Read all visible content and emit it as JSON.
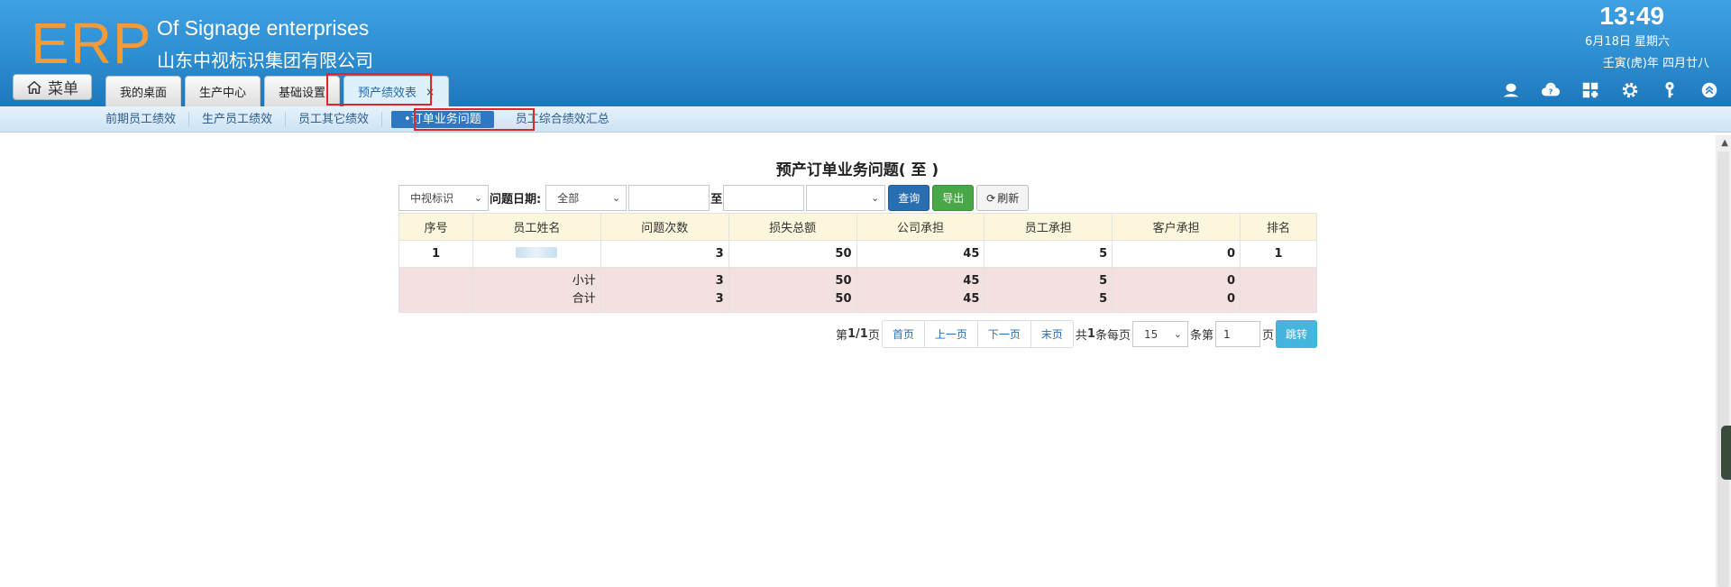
{
  "header": {
    "logo": "ERP",
    "enterprise_en": "Of Signage enterprises",
    "enterprise_cn": "山东中视标识集团有限公司",
    "time": "13:49",
    "date": "6月18日 星期六",
    "lunar": "壬寅(虎)年 四月廿八",
    "menu_label": "菜单"
  },
  "tabs": [
    {
      "label": "我的桌面"
    },
    {
      "label": "生产中心"
    },
    {
      "label": "基础设置"
    },
    {
      "label": "预产绩效表",
      "close": "×"
    }
  ],
  "toolbar_icons": [
    "user-icon",
    "help-cloud-icon",
    "dashboard-icon",
    "settings-gear-icon",
    "key-icon",
    "collapse-up-icon"
  ],
  "subnav": [
    {
      "label": "前期员工绩效"
    },
    {
      "label": "生产员工绩效"
    },
    {
      "label": "员工其它绩效"
    },
    {
      "label": "•订单业务问题"
    },
    {
      "label": "员工综合绩效汇总"
    }
  ],
  "page": {
    "title": "预产订单业务问题( 至 )"
  },
  "filter": {
    "company": "中视标识",
    "date_label": "问题日期:",
    "date_range": "全部",
    "to_label": "至",
    "extra_select": "",
    "query": "查询",
    "export": "导出",
    "refresh": "刷新"
  },
  "table": {
    "headers": [
      "序号",
      "员工姓名",
      "问题次数",
      "损失总额",
      "公司承担",
      "员工承担",
      "客户承担",
      "排名"
    ],
    "rows": [
      {
        "no": "1",
        "name": "",
        "count": "3",
        "loss": "50",
        "company": "45",
        "employee": "5",
        "customer": "0",
        "rank": "1"
      }
    ],
    "subtotal": {
      "label": "小计",
      "count": "3",
      "loss": "50",
      "company": "45",
      "employee": "5",
      "customer": "0"
    },
    "total": {
      "label": "合计",
      "count": "3",
      "loss": "50",
      "company": "45",
      "employee": "5",
      "customer": "0"
    }
  },
  "pager": {
    "page_prefix": "第",
    "page_info": "1/1",
    "page_suffix": "页",
    "first": "首页",
    "prev": "上一页",
    "next": "下一页",
    "last": "末页",
    "total_prefix": "共",
    "total_count": "1",
    "per_page_label": "条每页",
    "per_page": "15",
    "goto_prefix": "条第",
    "goto_value": "1",
    "goto_suffix": "页",
    "jump": "跳转"
  },
  "colors": {
    "header_top": "#3ea1e2",
    "header_bottom": "#1f77bb",
    "logo": "#f39a3a",
    "highlight_box": "#e0262b",
    "table_header_bg": "#fcf6dc",
    "summary_bg": "#f3e0e0"
  }
}
